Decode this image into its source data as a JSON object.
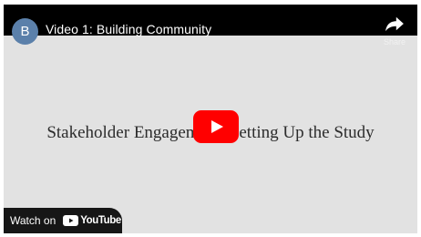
{
  "player": {
    "channel_initial": "B",
    "title": "Video 1: Building Community",
    "share_label": "Share",
    "slide_text": "Stakeholder Engagement: Setting Up the Study",
    "watch_on_label": "Watch on",
    "youtube_wordmark": "YouTube",
    "colors": {
      "play_red": "#ff0000",
      "avatar": "#5b80aa",
      "bar": "#000000",
      "background": "#e2e2e2"
    },
    "icons": [
      "share-icon",
      "play-icon",
      "youtube-logo-icon"
    ]
  }
}
